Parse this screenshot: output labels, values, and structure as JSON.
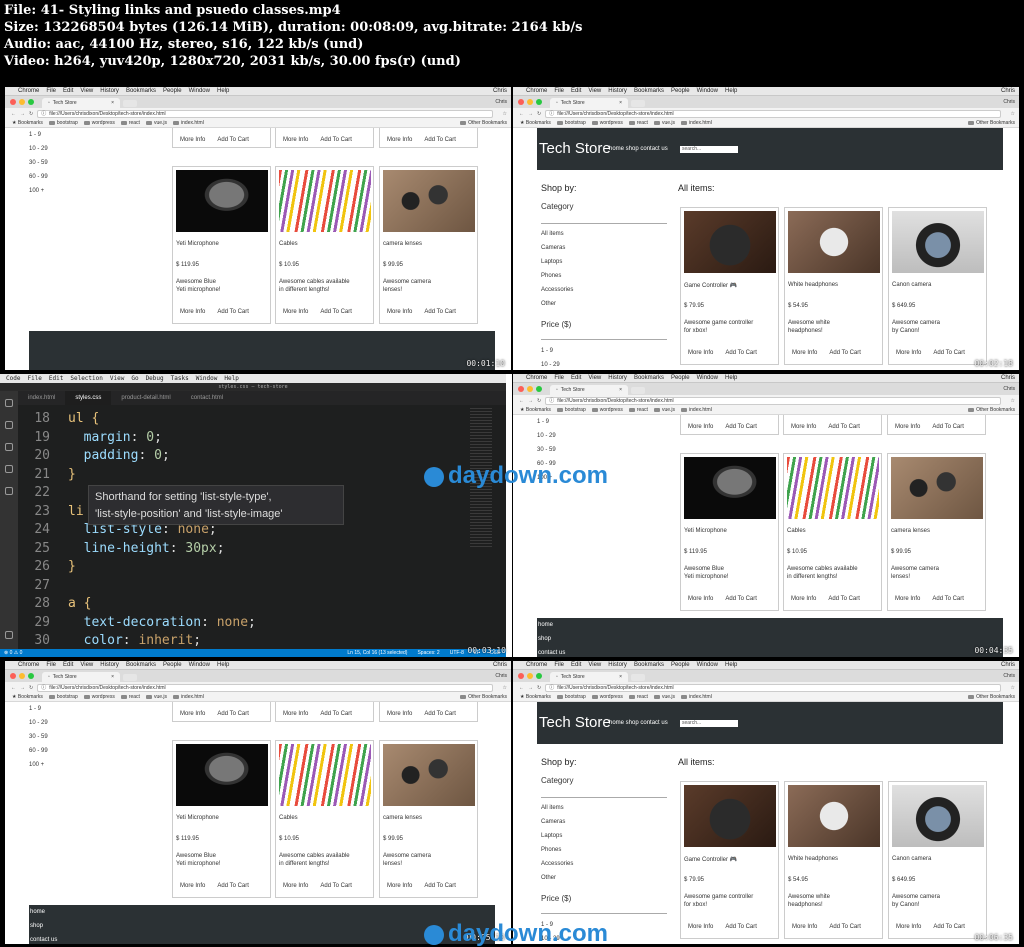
{
  "header": {
    "line1": "File: 41- Styling links and psuedo classes.mp4",
    "line2": "Size: 132268504 bytes (126.14 MiB), duration: 00:08:09, avg.bitrate: 2164 kb/s",
    "line3": "Audio: aac, 44100 Hz, stereo, s16, 122 kb/s (und)",
    "line4": "Video: h264, yuv420p, 1280x720, 2031 kb/s, 30.00 fps(r) (und)"
  },
  "watermark": "daydown.com",
  "browser": {
    "menu": [
      "Chrome",
      "File",
      "Edit",
      "View",
      "History",
      "Bookmarks",
      "People",
      "Window",
      "Help"
    ],
    "user": "Chris",
    "tab_title": "Tech Store",
    "url": "file:///Users/chrisdixon/Desktop/tech-store/index.html",
    "bookmarks_label": "Bookmarks",
    "bookmarks": [
      "bootstrap",
      "wordpress",
      "react",
      "vue.js",
      "index.html"
    ],
    "other_bookmarks": "Other Bookmarks"
  },
  "site": {
    "logo": "Tech Store",
    "nav": "home shop contact us",
    "search_placeholder": "search...",
    "shop_by": "Shop by:",
    "category": "Category",
    "categories": [
      "All items",
      "Cameras",
      "Laptops",
      "Phones",
      "Accessories",
      "Other"
    ],
    "price_heading": "Price ($)",
    "price_ranges": [
      "1 - 9",
      "10 - 29",
      "30 - 59",
      "60 - 99",
      "100 +"
    ],
    "all_items": "All items:",
    "more_info": "More Info",
    "add_to_cart": "Add To Cart",
    "products_top": [
      {
        "name": "Game Controller 🎮",
        "price": "$ 79.95",
        "desc1": "Awesome game controller",
        "desc2": "for xbox!"
      },
      {
        "name": "White headphones",
        "price": "$ 54.95",
        "desc1": "Awesome white",
        "desc2": "headphones!"
      },
      {
        "name": "Canon camera",
        "price": "$ 649.95",
        "desc1": "Awesome camera",
        "desc2": "by Canon!"
      }
    ],
    "products_bottom": [
      {
        "name": "Yeti Microphone",
        "price": "$ 119.95",
        "desc1": "Awesome Blue",
        "desc2": "Yeti microphone!"
      },
      {
        "name": "Cables",
        "price": "$ 10.95",
        "desc1": "Awesome cables available",
        "desc2": "in different lengths!"
      },
      {
        "name": "camera lenses",
        "price": "$ 99.95",
        "desc1": "Awesome camera",
        "desc2": "lenses!"
      }
    ],
    "footer_links": [
      "home",
      "shop",
      "contact us"
    ]
  },
  "timestamps": [
    "00:01:10",
    "00:02:18",
    "00:03:10",
    "00:04:35",
    "00:05:10",
    "00:06:35"
  ],
  "editor": {
    "menu": [
      "Code",
      "File",
      "Edit",
      "Selection",
      "View",
      "Go",
      "Debug",
      "Tasks",
      "Window",
      "Help"
    ],
    "title": "styles.css — tech-store",
    "tabs": [
      "index.html",
      "styles.css",
      "product-detail.html",
      "contact.html"
    ],
    "tooltip1": "Shorthand for setting 'list-style-type',",
    "tooltip2": "'list-style-position' and 'list-style-image'",
    "status_left": "⊗ 0 ⚠ 0",
    "status_right": [
      "Ln 15, Col 16 (13 selected)",
      "Spaces: 2",
      "UTF-8",
      "LF",
      "CSS"
    ],
    "lines": [
      {
        "n": "18",
        "t": "ul {"
      },
      {
        "n": "19",
        "p": "margin",
        "v": "0"
      },
      {
        "n": "20",
        "p": "padding",
        "v": "0"
      },
      {
        "n": "21",
        "t": "}"
      },
      {
        "n": "22",
        "t": ""
      },
      {
        "n": "23",
        "t": "li {"
      },
      {
        "n": "24",
        "p": "list-style",
        "v": "none"
      },
      {
        "n": "25",
        "p": "line-height",
        "v": "30px"
      },
      {
        "n": "26",
        "t": "}"
      },
      {
        "n": "27",
        "t": ""
      },
      {
        "n": "28",
        "t": "a {"
      },
      {
        "n": "29",
        "p": "text-decoration",
        "v": "none"
      },
      {
        "n": "30",
        "p": "color",
        "v": "inherit"
      }
    ]
  }
}
